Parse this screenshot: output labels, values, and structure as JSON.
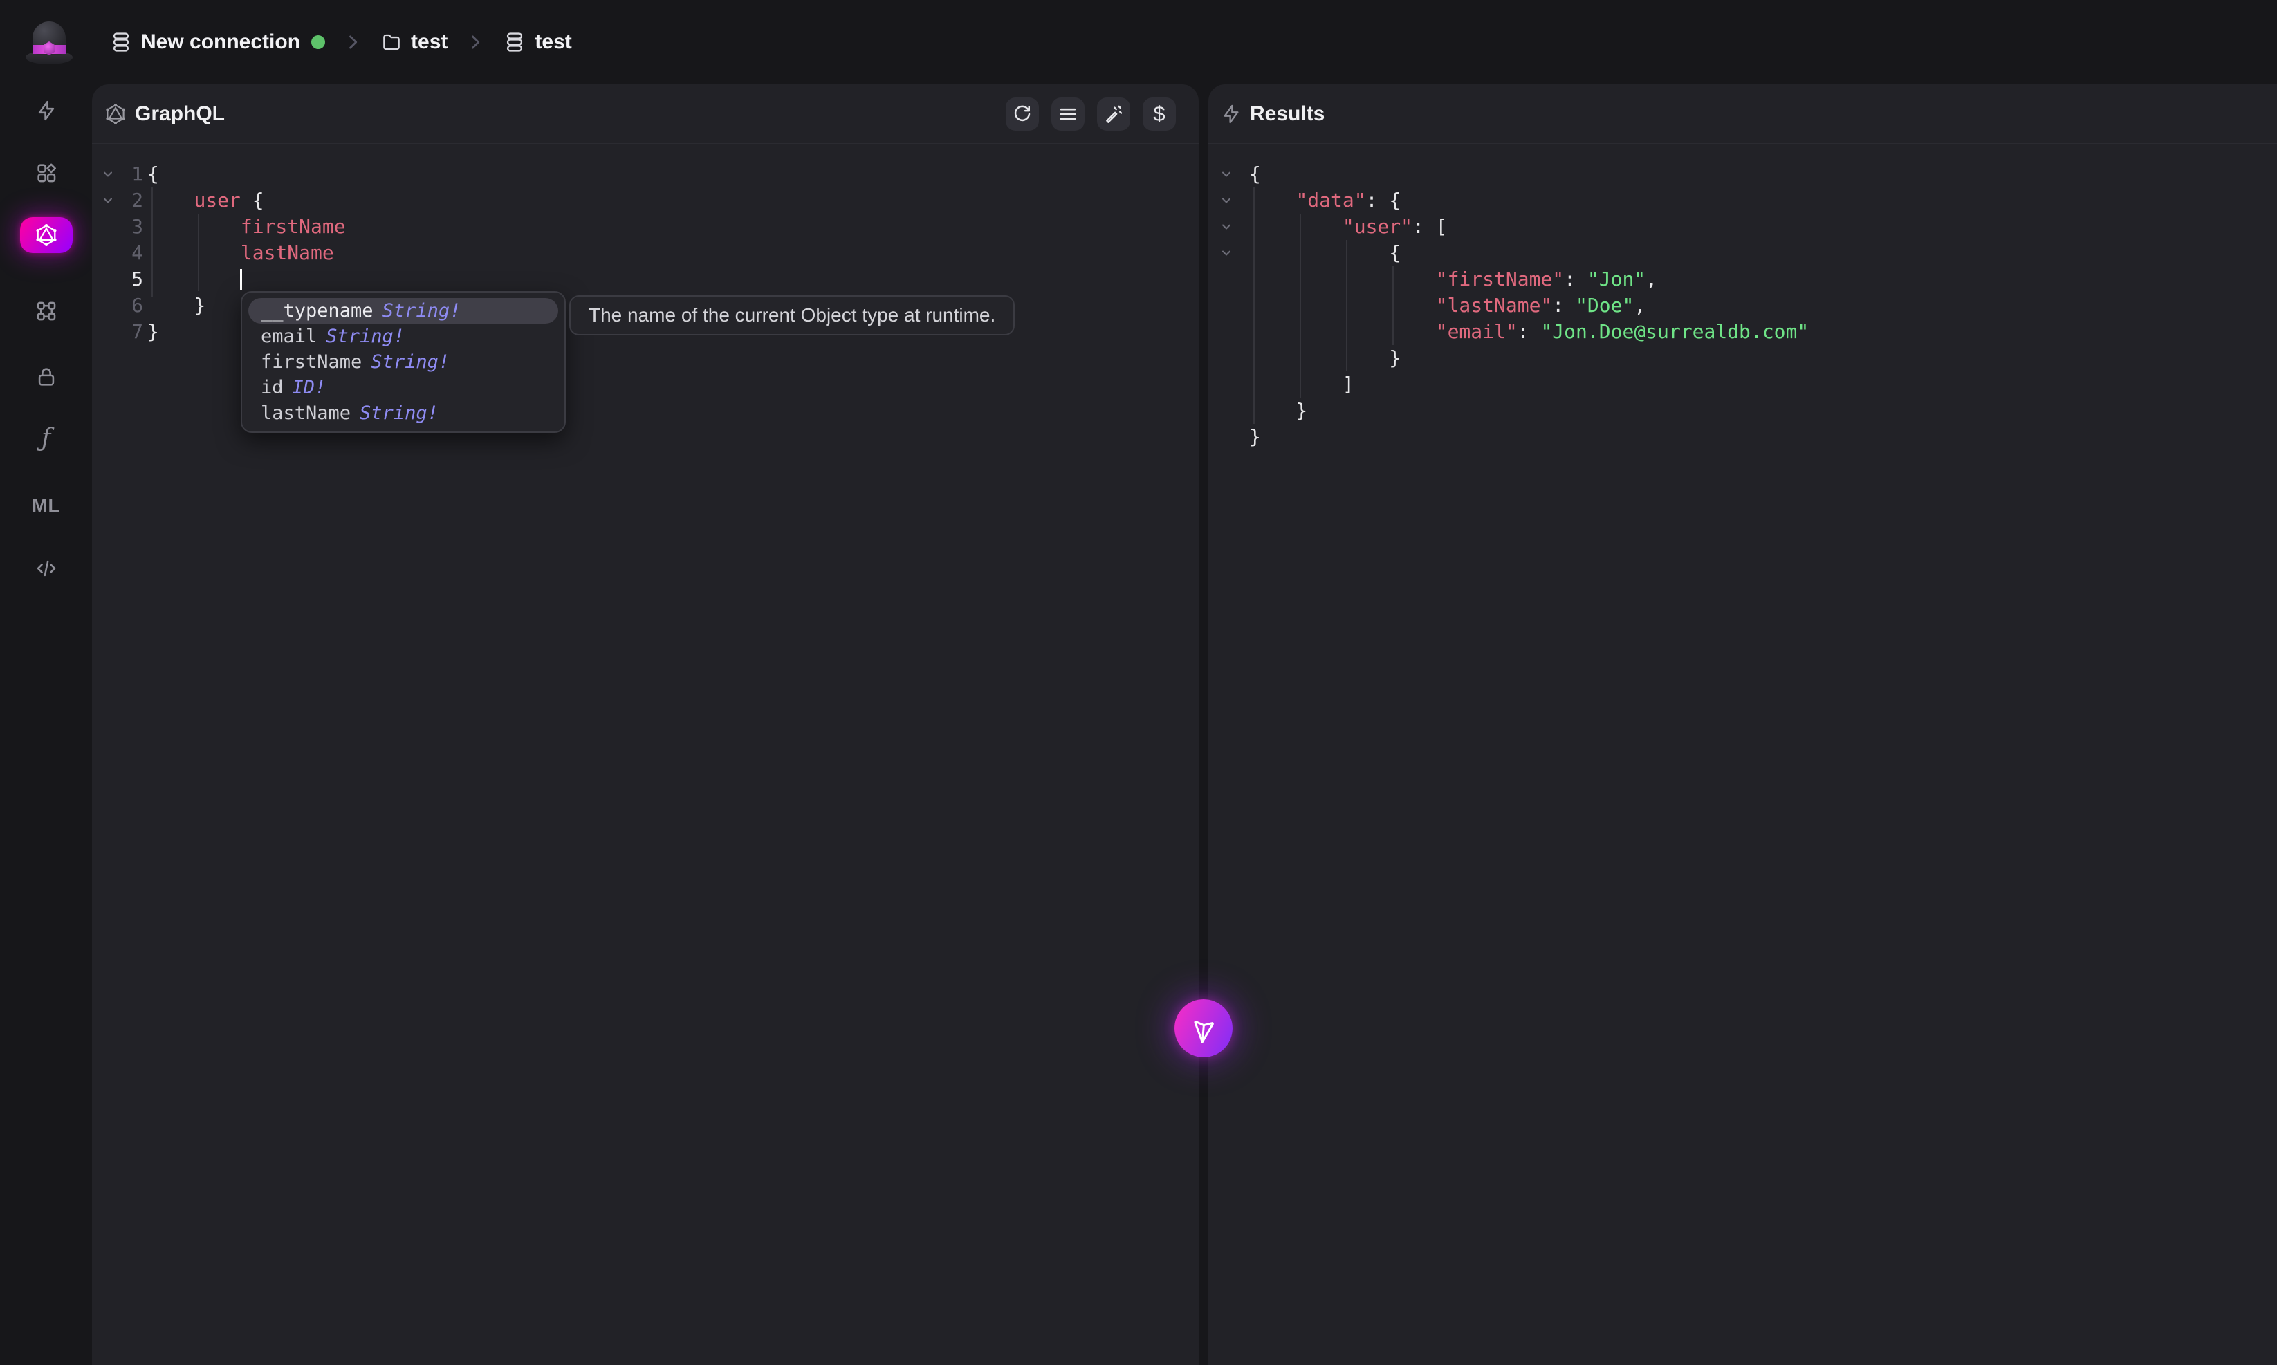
{
  "topbar": {
    "connection_label": "New connection",
    "connection_status": "connected",
    "namespace": "test",
    "database": "test"
  },
  "sidebar": {
    "items": [
      {
        "icon": "bolt-icon",
        "name": "query"
      },
      {
        "icon": "explorer-grid-icon",
        "name": "explorer"
      },
      {
        "icon": "graphql-icon",
        "name": "graphql",
        "active": true
      },
      {
        "icon": "designer-nodes-icon",
        "name": "designer"
      },
      {
        "icon": "lock-icon",
        "name": "authentication"
      },
      {
        "icon": "function-icon",
        "name": "functions",
        "glyph": "ƒ"
      },
      {
        "icon": "ml-icon",
        "name": "models",
        "glyph": "ML"
      },
      {
        "icon": "code-icon",
        "name": "api-docs"
      }
    ]
  },
  "graphql_panel": {
    "title": "GraphQL",
    "toolbar": [
      "refresh-icon",
      "format-lines-icon",
      "wand-icon",
      "variables-dollar-icon"
    ],
    "toolbar_dollar_glyph": "$",
    "editor": {
      "lines": [
        {
          "num": "1",
          "fold": true,
          "active": false,
          "tokens": [
            {
              "t": "{",
              "c": "punct"
            }
          ]
        },
        {
          "num": "2",
          "fold": true,
          "active": false,
          "tokens": [
            {
              "t": "    ",
              "c": "punct"
            },
            {
              "t": "user",
              "c": "field"
            },
            {
              "t": " {",
              "c": "punct"
            }
          ]
        },
        {
          "num": "3",
          "fold": false,
          "active": false,
          "tokens": [
            {
              "t": "        ",
              "c": "punct"
            },
            {
              "t": "firstName",
              "c": "field"
            }
          ]
        },
        {
          "num": "4",
          "fold": false,
          "active": false,
          "tokens": [
            {
              "t": "        ",
              "c": "punct"
            },
            {
              "t": "lastName",
              "c": "field"
            }
          ]
        },
        {
          "num": "5",
          "fold": false,
          "active": true,
          "tokens": []
        },
        {
          "num": "6",
          "fold": false,
          "active": false,
          "tokens": [
            {
              "t": "    }",
              "c": "punct"
            }
          ]
        },
        {
          "num": "7",
          "fold": false,
          "active": false,
          "tokens": [
            {
              "t": "}",
              "c": "punct"
            }
          ]
        }
      ]
    },
    "autocomplete": {
      "items": [
        {
          "name": "__typename",
          "type": "String!",
          "selected": true
        },
        {
          "name": "email",
          "type": "String!",
          "selected": false
        },
        {
          "name": "firstName",
          "type": "String!",
          "selected": false
        },
        {
          "name": "id",
          "type": "ID!",
          "selected": false
        },
        {
          "name": "lastName",
          "type": "String!",
          "selected": false
        }
      ],
      "tooltip": "The name of the current Object type at runtime."
    }
  },
  "results_panel": {
    "title": "Results",
    "lines": [
      {
        "fold": true,
        "tokens": [
          {
            "t": "{",
            "c": "punct"
          }
        ]
      },
      {
        "fold": true,
        "tokens": [
          {
            "t": "    ",
            "c": "punct"
          },
          {
            "t": "\"data\"",
            "c": "key"
          },
          {
            "t": ": {",
            "c": "punct"
          }
        ]
      },
      {
        "fold": true,
        "tokens": [
          {
            "t": "        ",
            "c": "punct"
          },
          {
            "t": "\"user\"",
            "c": "key"
          },
          {
            "t": ": [",
            "c": "punct"
          }
        ]
      },
      {
        "fold": true,
        "tokens": [
          {
            "t": "            {",
            "c": "punct"
          }
        ]
      },
      {
        "fold": false,
        "tokens": [
          {
            "t": "                ",
            "c": "punct"
          },
          {
            "t": "\"firstName\"",
            "c": "key"
          },
          {
            "t": ": ",
            "c": "punct"
          },
          {
            "t": "\"Jon\"",
            "c": "str"
          },
          {
            "t": ",",
            "c": "punct"
          }
        ]
      },
      {
        "fold": false,
        "tokens": [
          {
            "t": "                ",
            "c": "punct"
          },
          {
            "t": "\"lastName\"",
            "c": "key"
          },
          {
            "t": ": ",
            "c": "punct"
          },
          {
            "t": "\"Doe\"",
            "c": "str"
          },
          {
            "t": ",",
            "c": "punct"
          }
        ]
      },
      {
        "fold": false,
        "tokens": [
          {
            "t": "                ",
            "c": "punct"
          },
          {
            "t": "\"email\"",
            "c": "key"
          },
          {
            "t": ": ",
            "c": "punct"
          },
          {
            "t": "\"Jon.Doe@surrealdb.com\"",
            "c": "str"
          }
        ]
      },
      {
        "fold": false,
        "tokens": [
          {
            "t": "            }",
            "c": "punct"
          }
        ]
      },
      {
        "fold": false,
        "tokens": [
          {
            "t": "        ]",
            "c": "punct"
          }
        ]
      },
      {
        "fold": false,
        "tokens": [
          {
            "t": "    }",
            "c": "punct"
          }
        ]
      },
      {
        "fold": false,
        "tokens": [
          {
            "t": "}",
            "c": "punct"
          }
        ]
      }
    ]
  },
  "fab": {
    "icon": "send-icon"
  },
  "colors": {
    "page_bg": "#17171a",
    "panel_bg": "#222227",
    "accent_gradient_from": "#ff00a0",
    "accent_gradient_to": "#9600ff",
    "syntax_field": "#e0697e",
    "syntax_string": "#6fe487",
    "syntax_type": "#8e8bf2",
    "connection_status_green": "#5ec26a"
  }
}
